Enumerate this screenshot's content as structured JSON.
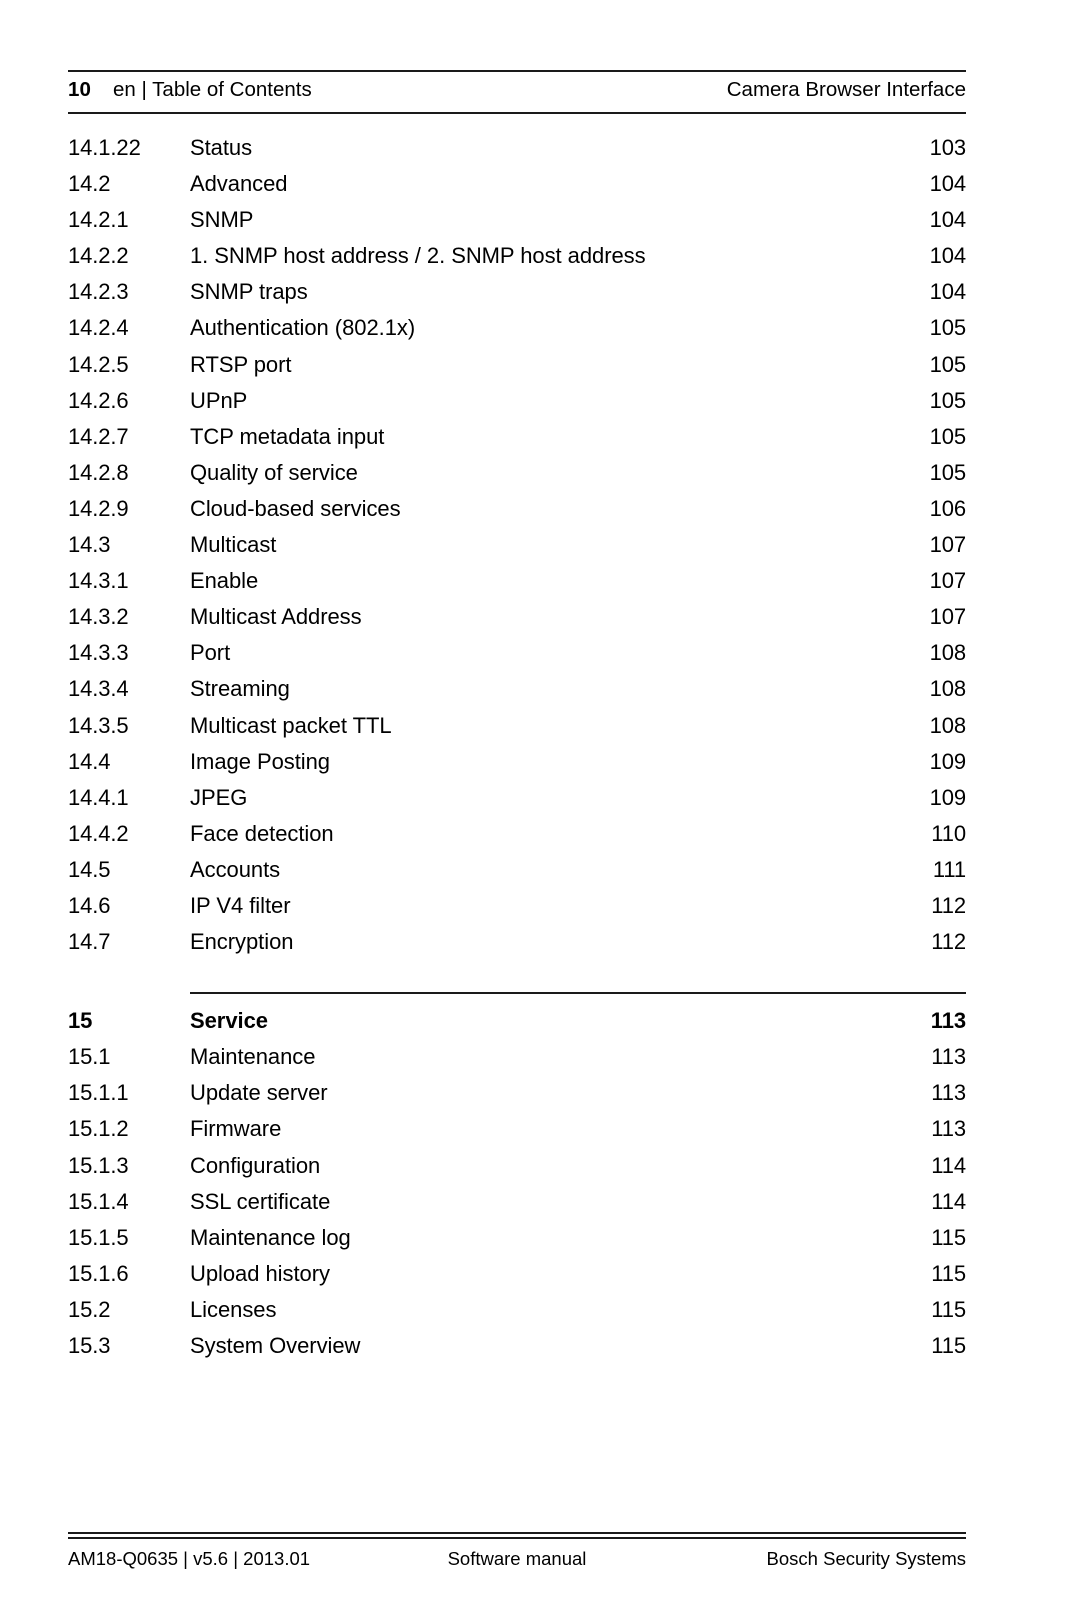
{
  "header": {
    "page_number": "10",
    "left_text": "en | Table of Contents",
    "right_text": "Camera Browser Interface"
  },
  "toc": {
    "entries": [
      {
        "number": "14.1.22",
        "title": "Status",
        "page": "103",
        "level": 3
      },
      {
        "number": "14.2",
        "title": "Advanced",
        "page": "104",
        "level": 2
      },
      {
        "number": "14.2.1",
        "title": "SNMP",
        "page": "104",
        "level": 3
      },
      {
        "number": "14.2.2",
        "title": "1. SNMP host address / 2. SNMP host address",
        "page": "104",
        "level": 3
      },
      {
        "number": "14.2.3",
        "title": "SNMP traps",
        "page": "104",
        "level": 3
      },
      {
        "number": "14.2.4",
        "title": "Authentication (802.1x)",
        "page": "105",
        "level": 3
      },
      {
        "number": "14.2.5",
        "title": "RTSP port",
        "page": "105",
        "level": 3
      },
      {
        "number": "14.2.6",
        "title": "UPnP",
        "page": "105",
        "level": 3
      },
      {
        "number": "14.2.7",
        "title": "TCP metadata input",
        "page": "105",
        "level": 3
      },
      {
        "number": "14.2.8",
        "title": "Quality of service",
        "page": "105",
        "level": 3
      },
      {
        "number": "14.2.9",
        "title": "Cloud-based services",
        "page": "106",
        "level": 3
      },
      {
        "number": "14.3",
        "title": "Multicast",
        "page": "107",
        "level": 2
      },
      {
        "number": "14.3.1",
        "title": "Enable",
        "page": "107",
        "level": 3
      },
      {
        "number": "14.3.2",
        "title": "Multicast Address",
        "page": "107",
        "level": 3
      },
      {
        "number": "14.3.3",
        "title": "Port",
        "page": "108",
        "level": 3
      },
      {
        "number": "14.3.4",
        "title": "Streaming",
        "page": "108",
        "level": 3
      },
      {
        "number": "14.3.5",
        "title": "Multicast packet TTL",
        "page": "108",
        "level": 3
      },
      {
        "number": "14.4",
        "title": "Image Posting",
        "page": "109",
        "level": 2
      },
      {
        "number": "14.4.1",
        "title": "JPEG",
        "page": "109",
        "level": 3
      },
      {
        "number": "14.4.2",
        "title": "Face detection",
        "page": "110",
        "level": 3
      },
      {
        "number": "14.5",
        "title": "Accounts",
        "page": "111",
        "level": 2
      },
      {
        "number": "14.6",
        "title": "IP V4 filter",
        "page": "112",
        "level": 2
      },
      {
        "number": "14.7",
        "title": "Encryption",
        "page": "112",
        "level": 2
      },
      {
        "number": "15",
        "title": "Service",
        "page": "113",
        "level": 1
      },
      {
        "number": "15.1",
        "title": "Maintenance",
        "page": "113",
        "level": 2
      },
      {
        "number": "15.1.1",
        "title": "Update server",
        "page": "113",
        "level": 3
      },
      {
        "number": "15.1.2",
        "title": "Firmware",
        "page": "113",
        "level": 3
      },
      {
        "number": "15.1.3",
        "title": "Configuration",
        "page": "114",
        "level": 3
      },
      {
        "number": "15.1.4",
        "title": "SSL certificate",
        "page": "114",
        "level": 3
      },
      {
        "number": "15.1.5",
        "title": "Maintenance log",
        "page": "115",
        "level": 3
      },
      {
        "number": "15.1.6",
        "title": "Upload history",
        "page": "115",
        "level": 3
      },
      {
        "number": "15.2",
        "title": "Licenses",
        "page": "115",
        "level": 2
      },
      {
        "number": "15.3",
        "title": "System Overview",
        "page": "115",
        "level": 2
      }
    ]
  },
  "footer": {
    "left_text": "AM18-Q0635 | v5.6 | 2013.01",
    "center_text": "Software manual",
    "right_text": "Bosch Security Systems"
  }
}
